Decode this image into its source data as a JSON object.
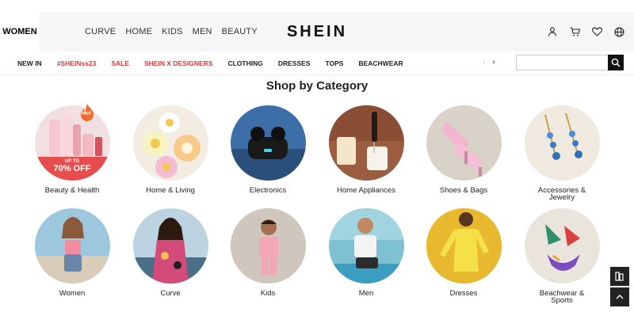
{
  "header": {
    "women_tab": "WOMEN",
    "nav": [
      "CURVE",
      "HOME",
      "KIDS",
      "MEN",
      "BEAUTY"
    ],
    "logo": "SHEIN"
  },
  "subnav": {
    "links": [
      {
        "label": "NEW IN",
        "color": "#222222"
      },
      {
        "label": "#SHEINss23",
        "color": "#d83a3a"
      },
      {
        "label": "SALE",
        "color": "#d83a3a"
      },
      {
        "label": "SHEIN X DESIGNERS",
        "color": "#d83a3a"
      },
      {
        "label": "CLOTHING",
        "color": "#222222"
      },
      {
        "label": "DRESSES",
        "color": "#222222"
      },
      {
        "label": "TOPS",
        "color": "#222222"
      },
      {
        "label": "BEACHWEAR",
        "color": "#222222"
      }
    ],
    "prev_arrow": "‹",
    "next_arrow": "›",
    "search_placeholder": ""
  },
  "section": {
    "title": "Shop by Category"
  },
  "categories": [
    {
      "label": "Beauty & Health",
      "label2": "",
      "promo_small": "UP TO",
      "promo_big": "70% OFF",
      "badge": "Hot",
      "bg": "#f1dfe2"
    },
    {
      "label": "Home & Living",
      "label2": "",
      "bg": "#f3ece2"
    },
    {
      "label": "Electronics",
      "label2": "",
      "bg": "#3c6ea7"
    },
    {
      "label": "Home Appliances",
      "label2": "",
      "bg": "#9c5c3f"
    },
    {
      "label": "Shoes & Bags",
      "label2": "",
      "bg": "#d8d2c8"
    },
    {
      "label": "Accessories &",
      "label2": "Jewelry",
      "bg": "#efe9df"
    },
    {
      "label": "Women",
      "label2": "",
      "bg": "#9dc7dd"
    },
    {
      "label": "Curve",
      "label2": "",
      "bg": "#bcd3e1"
    },
    {
      "label": "Kids",
      "label2": "",
      "bg": "#d9d3cb"
    },
    {
      "label": "Men",
      "label2": "",
      "bg": "#7ec1d2"
    },
    {
      "label": "Dresses",
      "label2": "",
      "bg": "#f0c93a"
    },
    {
      "label": "Beachwear &",
      "label2": "Sports",
      "bg": "#e9e4dc"
    }
  ]
}
